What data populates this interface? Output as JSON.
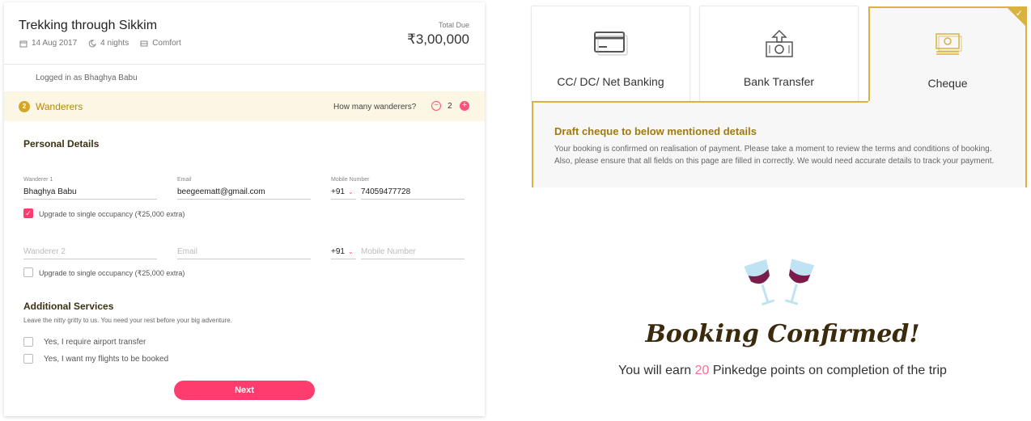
{
  "trip": {
    "title": "Trekking through Sikkim",
    "date": "14 Aug 2017",
    "nights": "4 nights",
    "category": "Comfort",
    "total_label": "Total Due",
    "total_value": "₹3,00,000"
  },
  "user": {
    "logged_in_text": "Logged in as Bhaghya Babu"
  },
  "wanderers": {
    "step": "2",
    "title": "Wanderers",
    "how_many_label": "How many wanderers?",
    "count": "2",
    "minus": "−",
    "plus": "+"
  },
  "personal_details": {
    "title": "Personal Details",
    "wanderer1": {
      "label": "Wanderer 1",
      "name": "Bhaghya Babu",
      "email_label": "Email",
      "email": "beegeematt@gmail.com",
      "mobile_label": "Mobile Number",
      "code": "+91",
      "mobile": "74059477728",
      "upgrade_label": "Upgrade to single occupancy (₹25,000 extra)",
      "upgrade_checked": true
    },
    "wanderer2": {
      "name_placeholder": "Wanderer 2",
      "email_placeholder": "Email",
      "code": "+91",
      "mobile_placeholder": "Mobile Number",
      "upgrade_label": "Upgrade to single occupancy (₹25,000 extra)",
      "upgrade_checked": false
    }
  },
  "additional_services": {
    "title": "Additional Services",
    "subtitle": "Leave the nitty gritty to us. You need your rest before your big adventure.",
    "airport_label": "Yes, I require airport transfer",
    "flights_label": "Yes, I want my flights to be booked"
  },
  "next_label": "Next",
  "payment": {
    "tabs": [
      {
        "label": "CC/ DC/ Net Banking",
        "icon": "credit-card-icon"
      },
      {
        "label": "Bank Transfer",
        "icon": "bank-transfer-icon"
      },
      {
        "label": "Cheque",
        "icon": "cheque-icon",
        "active": true
      }
    ],
    "cheque_title": "Draft cheque to below mentioned details",
    "cheque_desc": "Your booking is confirmed on realisation of payment. Please take a moment to review the terms and conditions of booking. Also, please ensure that all fields on this page are filled in correctly. We would need accurate details to track your payment."
  },
  "confirmation": {
    "title": "Booking Confirmed!",
    "earn_prefix": "You will earn",
    "points": "20",
    "earn_suffix": "Pinkedge points on completion of the trip"
  },
  "colors": {
    "accent": "#ff3c6e",
    "gold": "#d9b23f",
    "bar_bg": "#fcf6e5"
  }
}
